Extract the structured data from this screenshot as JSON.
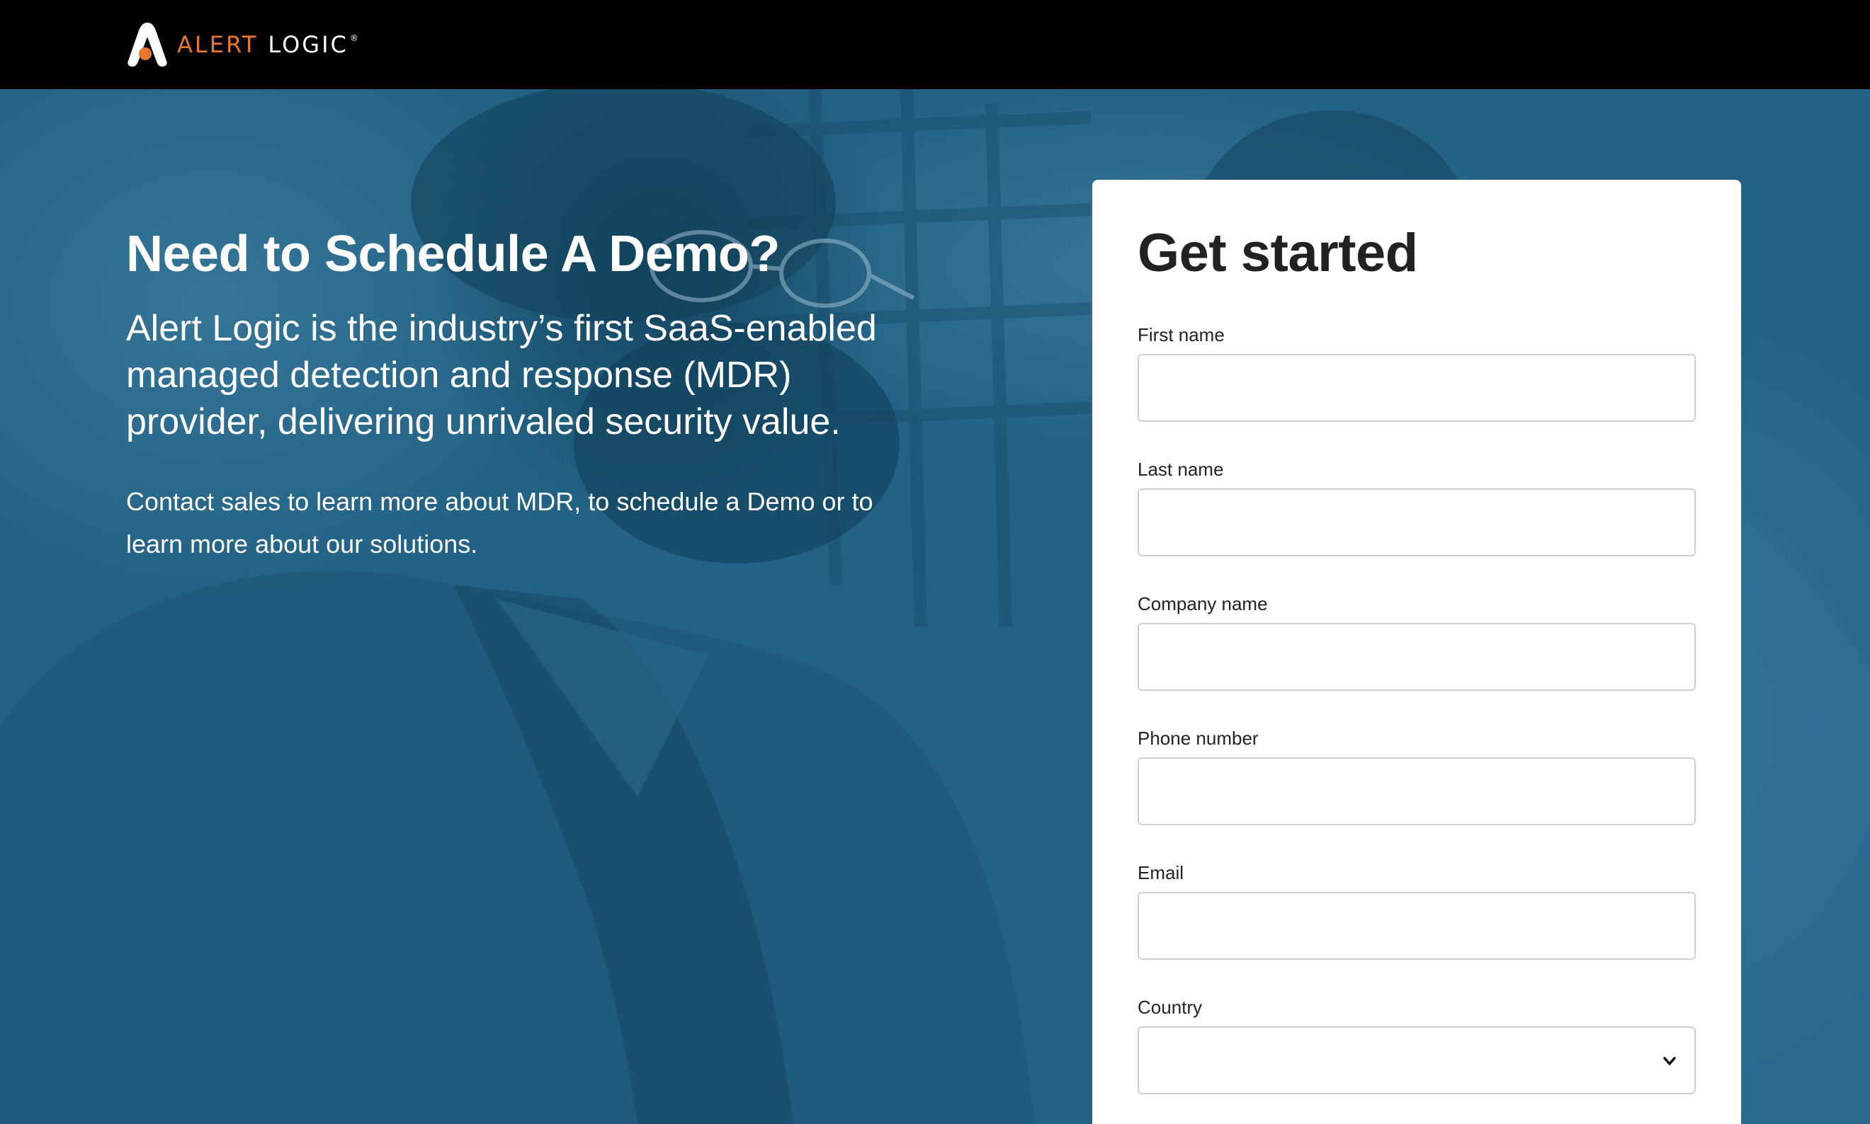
{
  "header": {
    "brand_word_1": "ALERT",
    "brand_word_2": "LOGIC",
    "brand_mark": "®",
    "brand_color": "#e8772e"
  },
  "hero": {
    "title": "Need to Schedule A Demo?",
    "lead": "Alert Logic is the industry’s first SaaS-enabled managed detection and response (MDR) provider, delivering unrivaled security value.",
    "sub": "Contact sales to learn more about MDR, to schedule a Demo or to learn more about our solutions.",
    "overlay_color": "#236284"
  },
  "form": {
    "title": "Get started",
    "fields": [
      {
        "label": "First name",
        "value": "",
        "type": "text"
      },
      {
        "label": "Last name",
        "value": "",
        "type": "text"
      },
      {
        "label": "Company name",
        "value": "",
        "type": "text"
      },
      {
        "label": "Phone number",
        "value": "",
        "type": "text"
      },
      {
        "label": "Email",
        "value": "",
        "type": "text"
      },
      {
        "label": "Country",
        "value": "",
        "type": "select"
      }
    ]
  },
  "icons": {
    "logo": "alert-logic-logo-icon",
    "select_arrow": "chevron-down-icon"
  }
}
